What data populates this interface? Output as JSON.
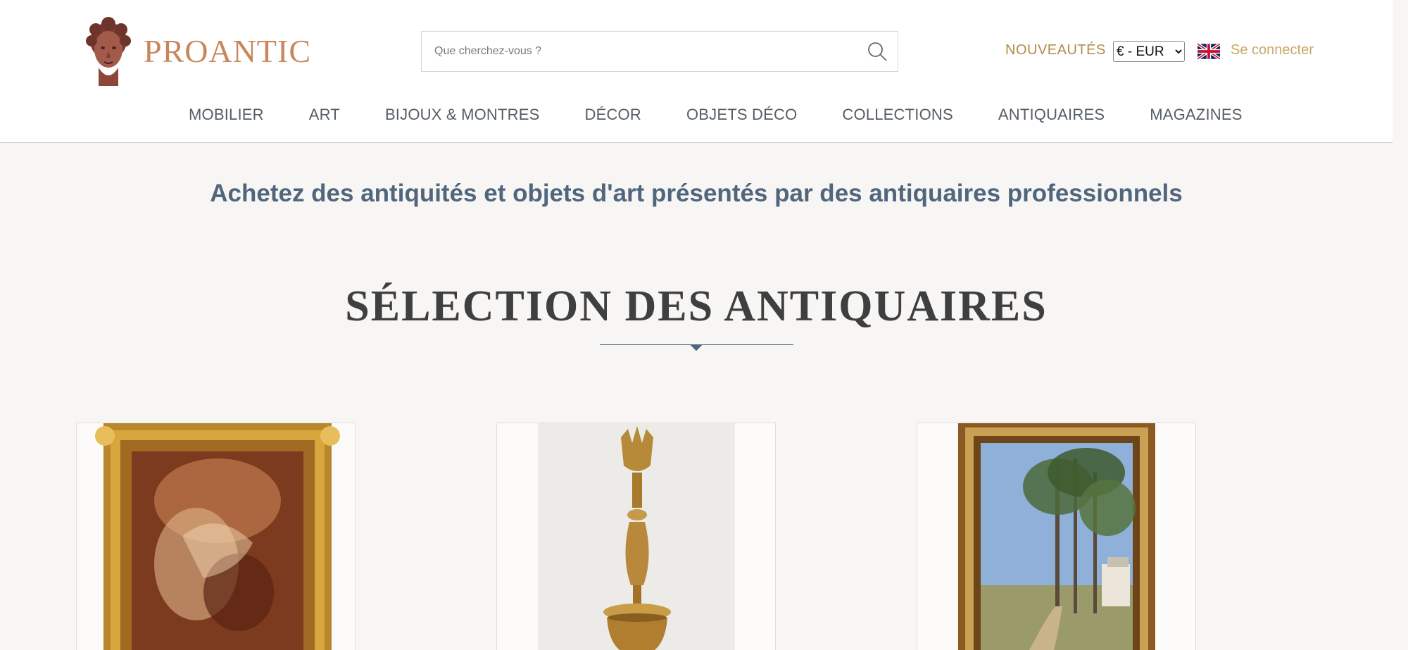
{
  "header": {
    "logo_text": "PROANTIC",
    "search": {
      "placeholder": "Que cherchez-vous ?"
    },
    "nouveautes": "NOUVEAUTÉS",
    "currency": {
      "selected": "€ - EUR"
    },
    "language_flag": "uk-flag-icon",
    "login": "Se connecter"
  },
  "nav": {
    "items": [
      {
        "label": "MOBILIER"
      },
      {
        "label": "ART"
      },
      {
        "label": "BIJOUX & MONTRES"
      },
      {
        "label": "DÉCOR"
      },
      {
        "label": "OBJETS DÉCO"
      },
      {
        "label": "COLLECTIONS"
      },
      {
        "label": "ANTIQUAIRES"
      },
      {
        "label": "MAGAZINES"
      }
    ]
  },
  "main": {
    "tagline": "Achetez des antiquités et objets d'art présentés par des antiquaires professionnels",
    "section_title": "SÉLECTION DES ANTIQUAIRES"
  },
  "colors": {
    "brand": "#c8875b",
    "nav_text": "#555e66",
    "accent_gold": "#b08d4a",
    "tagline": "#51667d"
  }
}
